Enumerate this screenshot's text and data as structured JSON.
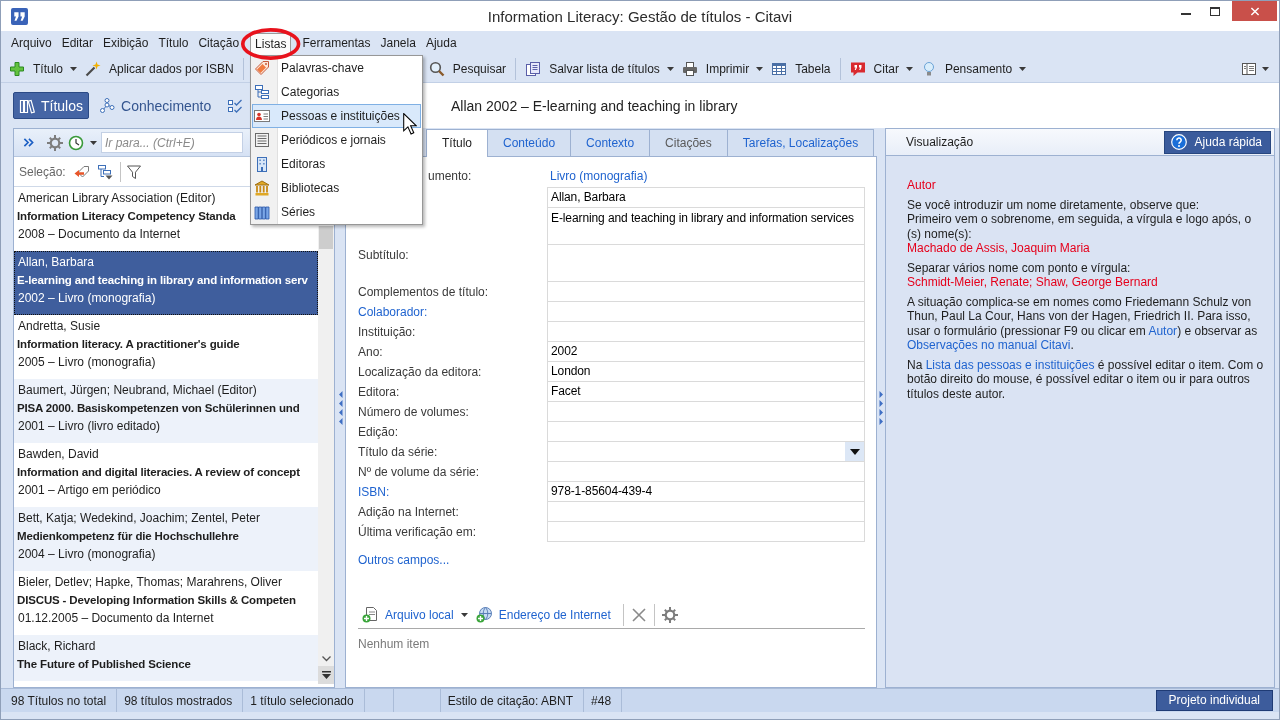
{
  "window": {
    "title": "Information Literacy: Gestão de títulos - Citavi"
  },
  "menu_bar": [
    {
      "label": "Arquivo",
      "open": false,
      "circled": false
    },
    {
      "label": "Editar",
      "open": false,
      "circled": false
    },
    {
      "label": "Exibição",
      "open": false,
      "circled": false
    },
    {
      "label": "Título",
      "open": false,
      "circled": false
    },
    {
      "label": "Citação",
      "open": false,
      "circled": false
    },
    {
      "label": "Listas",
      "open": true,
      "circled": true,
      "items": [
        {
          "label": "Palavras-chave",
          "selected": false
        },
        {
          "label": "Categorias",
          "selected": false
        },
        {
          "label": "Pessoas e instituições",
          "selected": true
        },
        {
          "label": "Periódicos e jornais",
          "selected": false
        },
        {
          "label": "Editoras",
          "selected": false
        },
        {
          "label": "Bibliotecas",
          "selected": false
        },
        {
          "label": "Séries",
          "selected": false
        }
      ]
    },
    {
      "label": "Ferramentas",
      "open": false,
      "circled": false
    },
    {
      "label": "Janela",
      "open": false,
      "circled": false
    },
    {
      "label": "Ajuda",
      "open": false,
      "circled": false
    }
  ],
  "toolbar": {
    "groups": [
      [
        {
          "label": "Título",
          "dropdown": true
        },
        {
          "label": "Aplicar dados por ISBN",
          "dropdown": false
        }
      ],
      [
        {
          "label": "Pesquisar",
          "dropdown": false
        }
      ],
      [
        {
          "label": "Salvar lista de títulos",
          "dropdown": true
        },
        {
          "label": "Imprimir",
          "dropdown": true
        },
        {
          "label": "Tabela",
          "dropdown": false
        }
      ],
      [
        {
          "label": "Citar",
          "dropdown": true
        },
        {
          "label": "Pensamento",
          "dropdown": true
        }
      ]
    ]
  },
  "nav": [
    {
      "label": "Títulos",
      "selected": true
    },
    {
      "label": "Conhecimento",
      "selected": false
    },
    {
      "selected": false
    }
  ],
  "reference_header": "Allan 2002 – E-learning and teaching in library",
  "titles_panel": {
    "search": {
      "placeholder": "Ir para... (Ctrl+E)"
    },
    "selection_label": "Seleção:",
    "items": [
      {
        "author": "American Library Association (Editor)",
        "title": "Information Literacy Competency Standa",
        "meta": "2008 – Documento da Internet",
        "selected": false
      },
      {
        "author": "Allan, Barbara",
        "title": "E-learning and teaching in library and information serv",
        "meta": "2002 – Livro (monografia)",
        "selected": true
      },
      {
        "author": "Andretta, Susie",
        "title": "Information literacy. A practitioner's guide",
        "meta": "2005 – Livro (monografia)",
        "selected": false
      },
      {
        "author": "Baumert, Jürgen; Neubrand, Michael (Editor)",
        "title": "PISA 2000. Basiskompetenzen von Schülerinnen und",
        "meta": "2001 – Livro (livro editado)",
        "selected": false
      },
      {
        "author": "Bawden, David",
        "title": "Information and digital literacies. A review of concept",
        "meta": "2001 – Artigo em periódico",
        "selected": false
      },
      {
        "author": "Bett, Katja; Wedekind, Joachim; Zentel, Peter",
        "title": "Medienkompetenz für die Hochschullehre",
        "meta": "2004 – Livro (monografia)",
        "selected": false
      },
      {
        "author": "Bieler, Detlev; Hapke, Thomas; Marahrens, Oliver",
        "title": "DISCUS - Developing Information Skills & Competen",
        "meta": "01.12.2005 – Documento da Internet",
        "selected": false
      },
      {
        "author": "Black, Richard",
        "title": "The Future of Published Science",
        "selected": false
      }
    ]
  },
  "tabs": [
    {
      "label": "Título",
      "selected": true,
      "disabled": false
    },
    {
      "label": "Conteúdo",
      "selected": false,
      "disabled": false
    },
    {
      "label": "Contexto",
      "selected": false,
      "disabled": false
    },
    {
      "label": "Citações",
      "selected": false,
      "disabled": true
    },
    {
      "label": "Tarefas, Localizações",
      "selected": false,
      "disabled": false
    }
  ],
  "form": {
    "fields": [
      {
        "label": {
          "kind": "plain",
          "text": "umento:"
        },
        "kind": "link",
        "value": "Livro (monografia)"
      },
      {
        "kind": "text",
        "value": "Allan, Barbara"
      },
      {
        "kind": "multiline",
        "value": "E-learning and teaching in library and information services"
      },
      {
        "label": {
          "kind": "plain",
          "text": "Subtítulo:"
        },
        "kind": "multiline"
      },
      {
        "label": {
          "kind": "plain",
          "text": "Complementos de título:"
        },
        "kind": "text"
      },
      {
        "label": {
          "kind": "link",
          "text": "Colaborador:"
        },
        "kind": "text"
      },
      {
        "label": {
          "kind": "plain",
          "text": "Instituição:"
        },
        "kind": "text"
      },
      {
        "label": {
          "kind": "plain",
          "text": "Ano:"
        },
        "kind": "text",
        "value": "2002"
      },
      {
        "label": {
          "kind": "plain",
          "text": "Localização da editora:"
        },
        "kind": "text",
        "value": "London"
      },
      {
        "label": {
          "kind": "plain",
          "text": "Editora:"
        },
        "kind": "text",
        "value": "Facet"
      },
      {
        "label": {
          "kind": "plain",
          "text": "Número de volumes:"
        },
        "kind": "text"
      },
      {
        "label": {
          "kind": "plain",
          "text": "Edição:"
        },
        "kind": "text"
      },
      {
        "label": {
          "kind": "plain",
          "text": "Título da série:"
        },
        "kind": "combo"
      },
      {
        "label": {
          "kind": "plain",
          "text": "Nº de volume da série:"
        },
        "kind": "text"
      },
      {
        "label": {
          "kind": "link",
          "text": "ISBN:"
        },
        "kind": "text",
        "value": "978-1-85604-439-4"
      },
      {
        "label": {
          "kind": "plain",
          "text": "Adição na Internet:"
        },
        "kind": "text"
      },
      {
        "label": {
          "kind": "plain",
          "text": "Última verificação em:"
        },
        "kind": "text"
      }
    ],
    "more_link": "Outros campos..."
  },
  "attachments": {
    "actions": [
      {
        "label": "Arquivo local",
        "dropdown": true
      },
      {
        "label": "Endereço de Internet",
        "dropdown": false
      }
    ],
    "empty_text": "Nenhum item"
  },
  "preview": {
    "title": "Visualização",
    "help_button": "Ajuda rápida",
    "paragraphs": [
      {
        "lines": [
          {
            "kind": "note",
            "text": "Autor"
          }
        ]
      },
      {
        "lines": [
          {
            "kind": "text",
            "parts": [
              {
                "kind": "plain",
                "text": "Se você introduzir um nome diretamente, observe que:"
              }
            ]
          },
          {
            "kind": "text",
            "parts": [
              {
                "kind": "plain",
                "text": "Primeiro vem o sobrenome, em seguida, a vírgula e logo após, o (s) nome(s):"
              }
            ]
          },
          {
            "kind": "note",
            "text": "Machado de Assis, Joaquim Maria"
          }
        ]
      },
      {
        "lines": [
          {
            "kind": "text",
            "parts": [
              {
                "kind": "plain",
                "text": "Separar vários nome com ponto e vírgula:"
              }
            ]
          },
          {
            "kind": "note",
            "text": "Schmidt-Meier, Renate; Shaw, George Bernard"
          }
        ]
      },
      {
        "lines": [
          {
            "kind": "text",
            "parts": [
              {
                "kind": "plain",
                "text": "A situação complica-se em nomes como Friedemann Schulz von Thun, Paul La Cour, Hans von der Hagen, Friedrich II. Para isso, usar o formulário (pressionar F9 ou clicar em "
              },
              {
                "kind": "link",
                "text": "Autor"
              },
              {
                "kind": "plain",
                "text": ") e observar as "
              },
              {
                "kind": "link",
                "text": "Observações no manual Citavi"
              },
              {
                "kind": "plain",
                "text": "."
              }
            ]
          }
        ]
      },
      {
        "lines": [
          {
            "kind": "text",
            "parts": [
              {
                "kind": "plain",
                "text": "Na "
              },
              {
                "kind": "link",
                "text": "Lista das pessoas e instituições"
              },
              {
                "kind": "plain",
                "text": " é possível editar o item. Com o botão direito do mouse, é possível editar o item ou ir para outros títulos deste autor."
              }
            ]
          }
        ]
      }
    ]
  },
  "status_bar": {
    "items": [
      "98 Títulos no total",
      "98 títulos mostrados",
      "1 título selecionado",
      "Estilo de citação: ABNT",
      "#48"
    ],
    "project": "Projeto individual"
  }
}
